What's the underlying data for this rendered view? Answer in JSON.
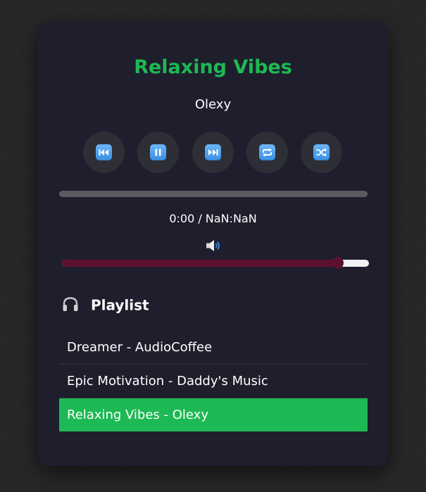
{
  "player": {
    "title": "Relaxing Vibes",
    "artist": "Olexy",
    "accent_color": "#1db954",
    "controls": [
      {
        "name": "previous-button",
        "icon": "previous-track-icon"
      },
      {
        "name": "pause-button",
        "icon": "pause-icon"
      },
      {
        "name": "next-button",
        "icon": "next-track-icon"
      },
      {
        "name": "repeat-button",
        "icon": "repeat-icon"
      },
      {
        "name": "shuffle-button",
        "icon": "shuffle-icon"
      }
    ],
    "progress_fraction": 0,
    "time_display": "0:00 / NaN:NaN",
    "volume_icon": "speaker-volume-icon",
    "volume_fraction": 0.9,
    "volume_color": "#5e1030"
  },
  "playlist": {
    "icon": "headphones-icon",
    "heading": "Playlist",
    "items": [
      {
        "label": "Dreamer - AudioCoffee",
        "active": false
      },
      {
        "label": "Epic Motivation - Daddy's Music",
        "active": false
      },
      {
        "label": "Relaxing Vibes - Olexy",
        "active": true
      }
    ]
  }
}
